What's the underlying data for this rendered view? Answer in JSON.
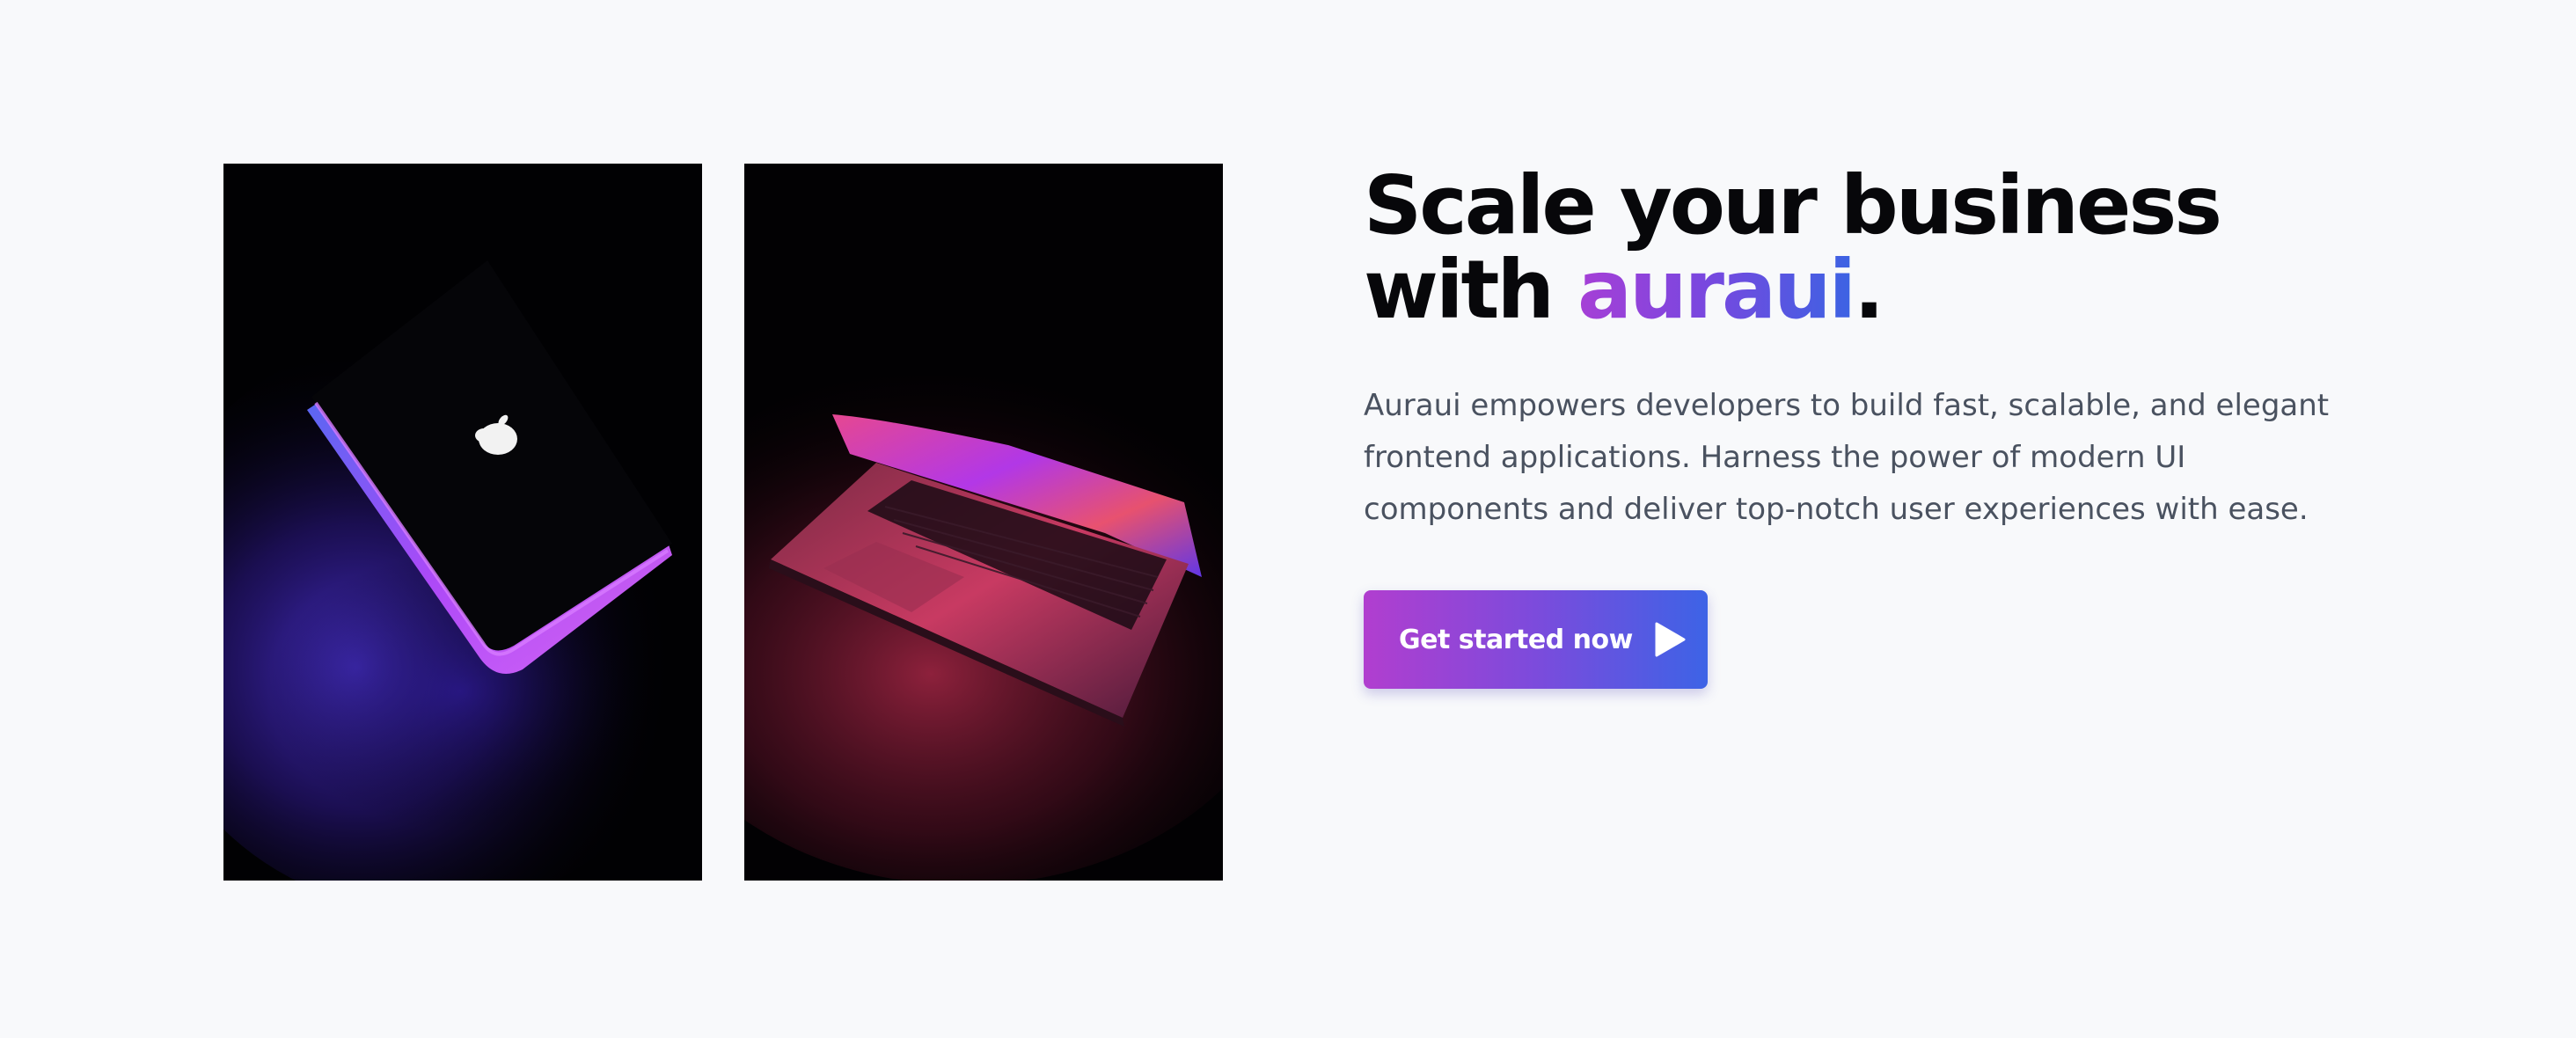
{
  "hero": {
    "heading_line1": "Scale your business",
    "heading_line2_prefix": "with ",
    "heading_brand": "auraui",
    "heading_period": ".",
    "description": "Auraui empowers developers to build fast, scalable, and elegant frontend applications. Harness the power of modern UI components and deliver top-notch user experiences with ease.",
    "cta_label": "Get started now",
    "cta_icon": "play-icon"
  },
  "images": {
    "left_icon": "laptop-closed-purple-glow",
    "right_icon": "laptop-open-pink-glow"
  },
  "colors": {
    "background": "#f8f9fb",
    "heading": "#07070a",
    "body_text": "#4a5260",
    "gradient_start": "#b13ecf",
    "gradient_end": "#3d63e6"
  }
}
